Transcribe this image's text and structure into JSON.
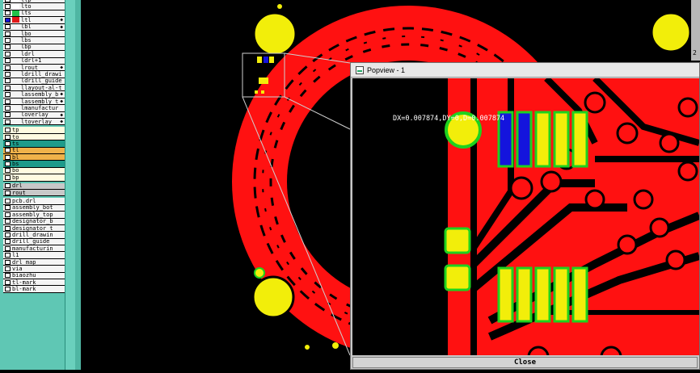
{
  "layers": {
    "group1": [
      {
        "name": "ltp",
        "color": "#ffffff",
        "checked": false,
        "ins": ""
      },
      {
        "name": "lto",
        "color": "#ffffff",
        "checked": false,
        "ins": ""
      },
      {
        "name": "lts",
        "color": "#22c24a",
        "checked": false,
        "ins": ""
      },
      {
        "name": "ltl",
        "color": "#e01818",
        "checked": true,
        "ins": "◆"
      },
      {
        "name": "lbl",
        "color": "",
        "checked": false,
        "ins": "◆"
      },
      {
        "name": "lbo",
        "color": "",
        "checked": false,
        "ins": ""
      },
      {
        "name": "lbs",
        "color": "",
        "checked": false,
        "ins": ""
      },
      {
        "name": "lbp",
        "color": "",
        "checked": false,
        "ins": ""
      },
      {
        "name": "ldrl",
        "color": "",
        "checked": false,
        "ins": ""
      },
      {
        "name": "ldrl+1",
        "color": "",
        "checked": false,
        "ins": ""
      },
      {
        "name": "lrout",
        "color": "",
        "checked": false,
        "ins": "◆"
      },
      {
        "name": "ldrill_drawi",
        "color": "",
        "checked": false,
        "ins": ""
      },
      {
        "name": "ldrill_guide",
        "color": "",
        "checked": false,
        "ins": ""
      },
      {
        "name": "llayout-al-t",
        "color": "",
        "checked": false,
        "ins": ""
      },
      {
        "name": "lassembly_b",
        "color": "",
        "checked": false,
        "ins": "◆"
      },
      {
        "name": "lassembly_t",
        "color": "",
        "checked": false,
        "ins": "◆"
      },
      {
        "name": "lmanufactur",
        "color": "",
        "checked": false,
        "ins": ""
      },
      {
        "name": "loverlay",
        "color": "",
        "checked": false,
        "ins": "◆"
      },
      {
        "name": "ltoverlay",
        "color": "",
        "checked": false,
        "ins": "◆"
      }
    ],
    "group2": [
      {
        "name": "tp",
        "bg": "#fffbe0"
      },
      {
        "name": "to",
        "bg": "#fffbe0"
      },
      {
        "name": "ts",
        "bg": "#1e9b8a"
      },
      {
        "name": "tl",
        "bg": "#f0b24a"
      },
      {
        "name": "bl",
        "bg": "#f0b24a"
      },
      {
        "name": "bs",
        "bg": "#1e9b8a"
      },
      {
        "name": "bo",
        "bg": "#fffbe0"
      },
      {
        "name": "bp",
        "bg": "#fffbe0"
      }
    ],
    "group3": [
      {
        "name": "drl",
        "bg": "#c8c8c8"
      },
      {
        "name": "rout",
        "bg": "#c8c8c8"
      }
    ],
    "group4": [
      {
        "name": "pcb.drl"
      },
      {
        "name": "assembly_bot"
      },
      {
        "name": "assembly_top"
      },
      {
        "name": "designator_b"
      },
      {
        "name": "designator_t"
      },
      {
        "name": "drill_drawin"
      },
      {
        "name": "drill_guide"
      },
      {
        "name": "manufacturin"
      },
      {
        "name": "l1"
      },
      {
        "name": "drl_map"
      },
      {
        "name": "via"
      },
      {
        "name": "biaozhu"
      },
      {
        "name": "tl-mark"
      },
      {
        "name": "bl-mark"
      }
    ]
  },
  "right_edge": {
    "value": "2"
  },
  "popup": {
    "title": "Popview - 1",
    "readout": "DX=0.007874,DY=0,D=0.007874",
    "close_label": "Close"
  },
  "colors": {
    "copper": "#ff1111",
    "pad": "#f2ee0a",
    "pad_outline": "#1ed21e",
    "selected": "#1414dd",
    "panel": "#5fc7b4"
  }
}
